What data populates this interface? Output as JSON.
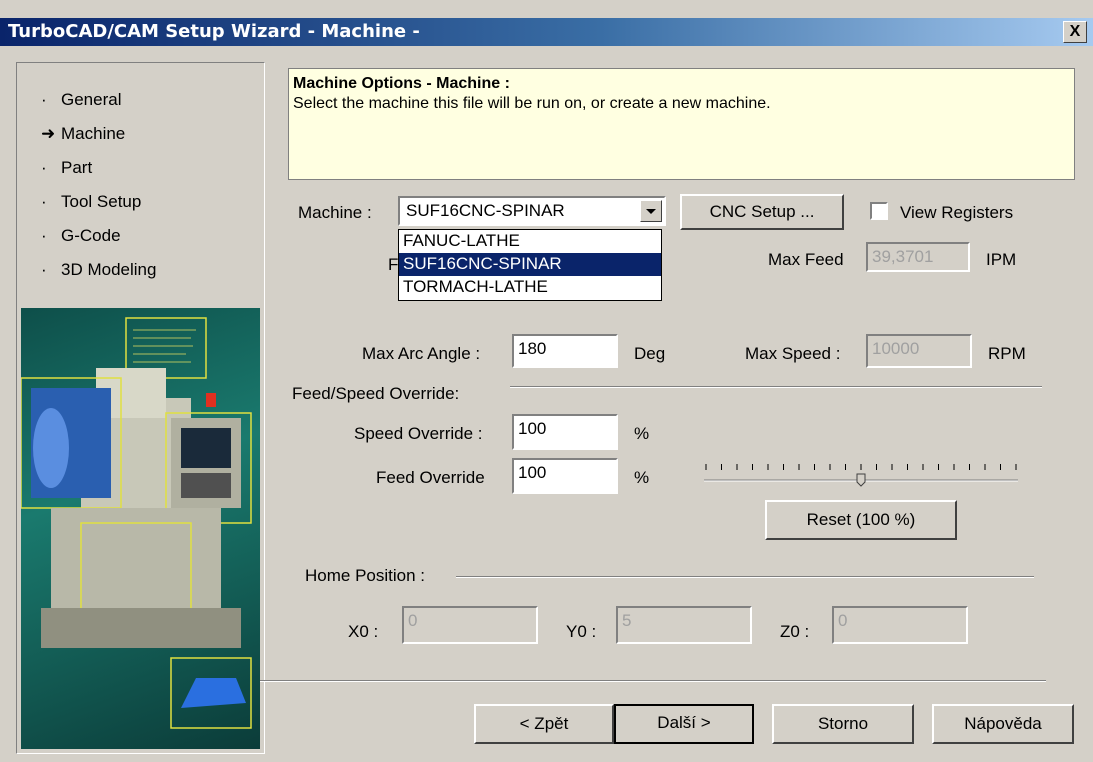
{
  "window": {
    "title": "TurboCAD/CAM Setup Wizard - Machine -",
    "close_glyph": "X"
  },
  "nav": {
    "items": [
      {
        "bullet": "·",
        "label": "General"
      },
      {
        "bullet": "➜",
        "label": "Machine"
      },
      {
        "bullet": "·",
        "label": "Part"
      },
      {
        "bullet": "·",
        "label": "Tool Setup"
      },
      {
        "bullet": "·",
        "label": "G-Code"
      },
      {
        "bullet": "·",
        "label": "3D Modeling"
      }
    ]
  },
  "info": {
    "title": "Machine Options - Machine :",
    "text": "Select the machine this file will be run on, or create a new machine."
  },
  "machine": {
    "label": "Machine :",
    "selected": "SUF16CNC-SPINAR",
    "options": [
      "FANUC-LATHE",
      "SUF16CNC-SPINAR",
      "TORMACH-LATHE"
    ],
    "partial_label": "F"
  },
  "cnc_setup_label": "CNC Setup ...",
  "view_registers": {
    "label": "View Registers",
    "checked": false
  },
  "max_feed": {
    "label": "Max Feed",
    "value": "39,3701",
    "unit": "IPM"
  },
  "max_arc": {
    "label": "Max Arc Angle :",
    "value": "180",
    "unit": "Deg"
  },
  "max_speed": {
    "label": "Max Speed :",
    "value": "10000",
    "unit": "RPM"
  },
  "override": {
    "group_label": "Feed/Speed Override:",
    "speed_label": "Speed Override :",
    "speed_value": "100",
    "speed_unit": "%",
    "feed_label": "Feed Override",
    "feed_value": "100",
    "feed_unit": "%",
    "slider_percent": 50,
    "reset_label": "Reset (100 %)"
  },
  "home": {
    "group_label": "Home Position :",
    "x_label": "X0 :",
    "x_value": "0",
    "y_label": "Y0 :",
    "y_value": "5",
    "z_label": "Z0 :",
    "z_value": "0"
  },
  "buttons": {
    "back": "< Zpět",
    "next": "Další >",
    "cancel": "Storno",
    "help": "Nápověda"
  },
  "colors": {
    "title_start": "#0a246a",
    "title_end": "#a6caf0",
    "info_bg": "#ffffe1",
    "selection": "#0a246a"
  }
}
